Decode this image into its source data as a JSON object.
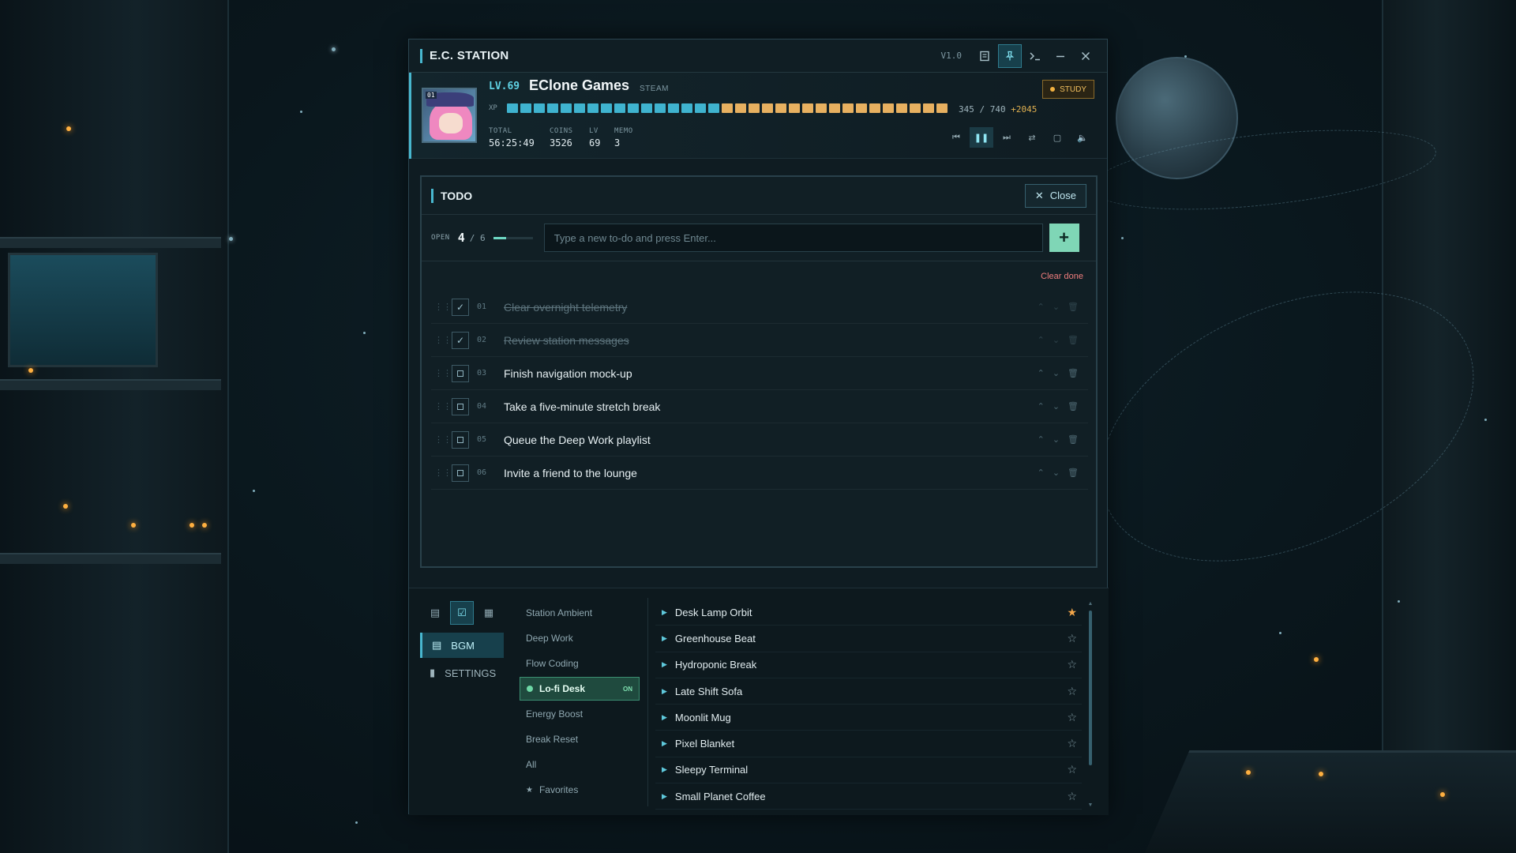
{
  "window": {
    "title": "E.C. STATION",
    "version": "V1.0"
  },
  "profile": {
    "level_label": "LV.69",
    "name": "EClone Games",
    "platform": "STEAM",
    "mode_label": "STUDY",
    "avatar_badge": "01",
    "xp_label": "XP",
    "xp_current": "345",
    "xp_separator": "/",
    "xp_total": "740",
    "xp_bonus": "+2045",
    "xp_segments_filled_blue": 16,
    "xp_segments_filled_gold": 17,
    "stats": [
      {
        "key": "TOTAL",
        "value": "56:25:49"
      },
      {
        "key": "COINS",
        "value": "3526"
      },
      {
        "key": "LV",
        "value": "69"
      },
      {
        "key": "MEMO",
        "value": "3"
      }
    ]
  },
  "todo": {
    "title": "TODO",
    "close_label": "Close",
    "open_label": "OPEN",
    "open_count": "4",
    "total_count": "/ 6",
    "progress_fraction": 0.33,
    "input_placeholder": "Type a new to-do and press Enter...",
    "add_label": "+",
    "clear_done_label": "Clear done",
    "items": [
      {
        "num": "01",
        "text": "Clear overnight telemetry",
        "done": true
      },
      {
        "num": "02",
        "text": "Review station messages",
        "done": true
      },
      {
        "num": "03",
        "text": "Finish navigation mock-up",
        "done": false
      },
      {
        "num": "04",
        "text": "Take a five-minute stretch break",
        "done": false
      },
      {
        "num": "05",
        "text": "Queue the Deep Work playlist",
        "done": false
      },
      {
        "num": "06",
        "text": "Invite a friend to the lounge",
        "done": false
      }
    ]
  },
  "nav": {
    "items": [
      {
        "label": "BGM",
        "active": true
      },
      {
        "label": "SETTINGS",
        "active": false
      }
    ]
  },
  "bgm": {
    "categories": [
      {
        "label": "Station Ambient"
      },
      {
        "label": "Deep Work"
      },
      {
        "label": "Flow Coding"
      },
      {
        "label": "Lo-fi Desk",
        "active": true,
        "tag": "ON"
      },
      {
        "label": "Energy Boost"
      },
      {
        "label": "Break Reset"
      },
      {
        "label": "All"
      },
      {
        "label": "Favorites",
        "star": true
      }
    ],
    "tracks": [
      {
        "title": "Desk Lamp Orbit",
        "favorite": true
      },
      {
        "title": "Greenhouse Beat",
        "favorite": false
      },
      {
        "title": "Hydroponic Break",
        "favorite": false
      },
      {
        "title": "Late Shift Sofa",
        "favorite": false
      },
      {
        "title": "Moonlit Mug",
        "favorite": false
      },
      {
        "title": "Pixel Blanket",
        "favorite": false
      },
      {
        "title": "Sleepy Terminal",
        "favorite": false
      },
      {
        "title": "Small Planet Coffee",
        "favorite": false
      }
    ]
  },
  "colors": {
    "accent": "#48b7cf",
    "xp_blue": "#3fb3cf",
    "xp_gold": "#e7b060",
    "add_button": "#7fd6b6",
    "danger": "#ef7d7d",
    "favorite": "#f2a64a"
  }
}
